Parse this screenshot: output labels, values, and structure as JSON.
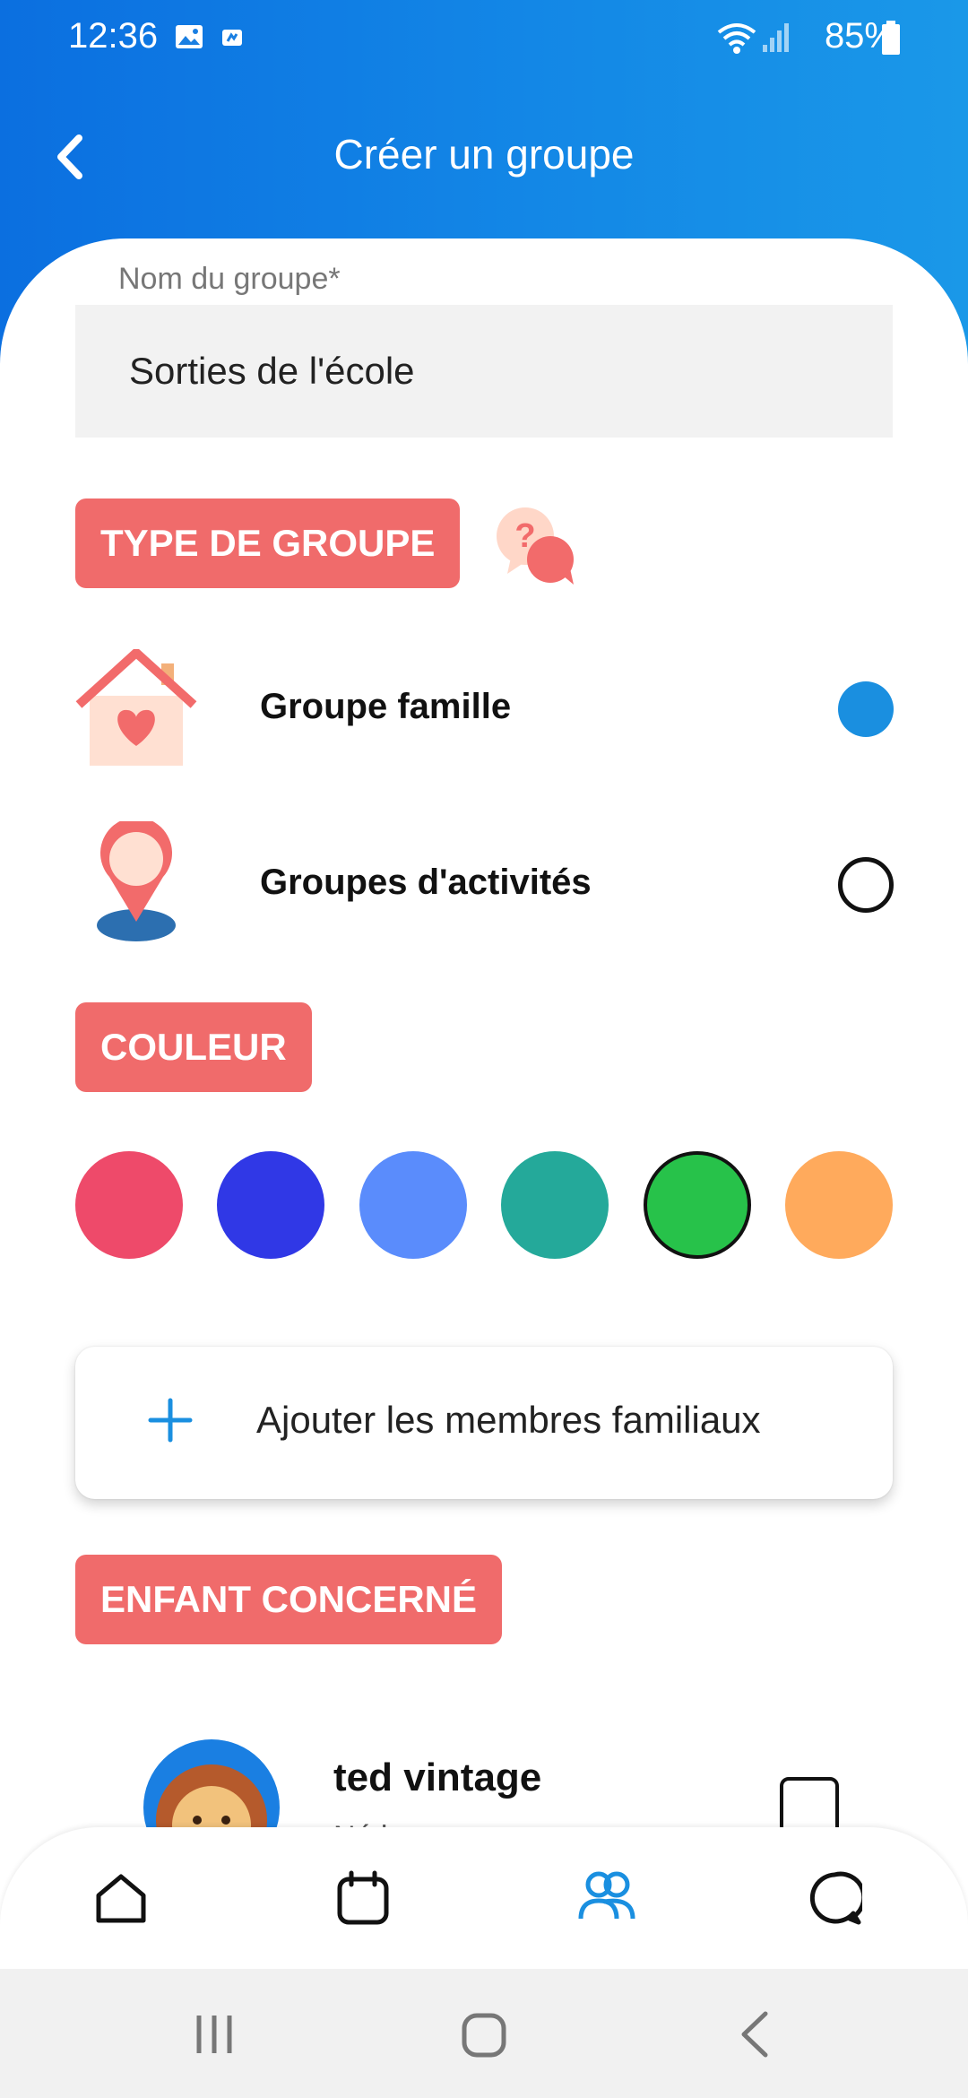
{
  "status_bar": {
    "time": "12:36",
    "battery": "85%"
  },
  "header": {
    "title": "Créer un groupe"
  },
  "form": {
    "name_label": "Nom du groupe*",
    "name_value": "Sorties de l'école"
  },
  "group_type": {
    "title": "TYPE DE GROUPE",
    "options": [
      {
        "label": "Groupe famille",
        "selected": true
      },
      {
        "label": "Groupes d'activités",
        "selected": false
      }
    ]
  },
  "color": {
    "title": "COULEUR",
    "swatches": [
      "#ee4a6a",
      "#3038e6",
      "#5a8cfc",
      "#24a99a",
      "#27c24a",
      "#ffaa5c"
    ],
    "selected_index": 4
  },
  "add_members": {
    "label": "Ajouter les membres familiaux",
    "icon": "plus-icon"
  },
  "child_section": {
    "title": "ENFANT CONCERNÉ",
    "children": [
      {
        "name": "ted vintage",
        "subtitle": "Né le ...",
        "avatar": "lion-avatar"
      }
    ]
  },
  "bottom_nav": {
    "items": [
      "home-icon",
      "calendar-icon",
      "group-icon",
      "chat-icon"
    ],
    "active": 2
  },
  "accent": "#f06b6b",
  "primary_blue": "#1a8fe0"
}
